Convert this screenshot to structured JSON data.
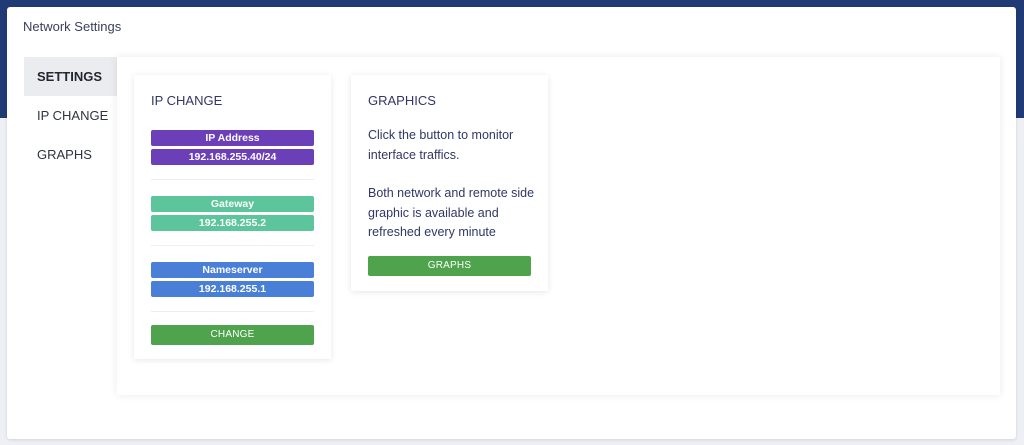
{
  "window": {
    "title": "Network Settings"
  },
  "sidebar": {
    "items": [
      {
        "label": "SETTINGS"
      },
      {
        "label": "IP CHANGE"
      },
      {
        "label": "GRAPHS"
      }
    ]
  },
  "ip_card": {
    "title": "IP CHANGE",
    "ip_label": "IP Address",
    "ip_value": "192.168.255.40/24",
    "gateway_label": "Gateway",
    "gateway_value": "192.168.255.2",
    "nameserver_label": "Nameserver",
    "nameserver_value": "192.168.255.1",
    "change_button": "CHANGE"
  },
  "graphics_card": {
    "title": "GRAPHICS",
    "text1": "Click the button to monitor interface traffics.",
    "text2": "Both network and remote side graphic is available and refreshed every minute",
    "graphs_button": "GRAPHS"
  },
  "colors": {
    "header": "#1f3a75",
    "ip_address": "#6b3fb8",
    "gateway": "#5cc59b",
    "nameserver": "#4a7fd8",
    "button": "#4ea34c"
  }
}
